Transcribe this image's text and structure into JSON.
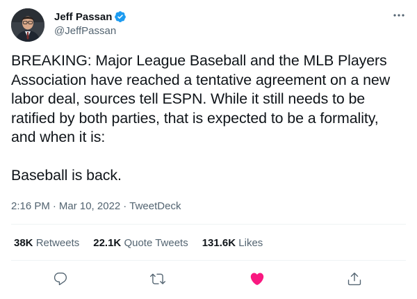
{
  "author": {
    "display_name": "Jeff Passan",
    "handle": "@JeffPassan",
    "verified": true
  },
  "tweet": {
    "paragraphs": [
      "BREAKING: Major League Baseball and the MLB Players Association have reached a tentative agreement on a new labor deal, sources tell ESPN. While it still needs to be ratified by both parties, that is expected to be a formality, and when it is:",
      "Baseball is back."
    ],
    "time": "2:16 PM",
    "date": "Mar 10, 2022",
    "source": "TweetDeck"
  },
  "stats": {
    "retweets_count": "38K",
    "retweets_label": "Retweets",
    "quotes_count": "22.1K",
    "quotes_label": "Quote Tweets",
    "likes_count": "131.6K",
    "likes_label": "Likes"
  },
  "icons": {
    "verified": "verified-badge-icon",
    "more": "more-options-icon",
    "reply": "reply-icon",
    "retweet": "retweet-icon",
    "like": "like-heart-icon",
    "share": "share-icon"
  },
  "colors": {
    "verified_blue": "#1d9bf0",
    "like_pink": "#f91880",
    "secondary_text": "#536471",
    "divider": "#eff3f4"
  }
}
